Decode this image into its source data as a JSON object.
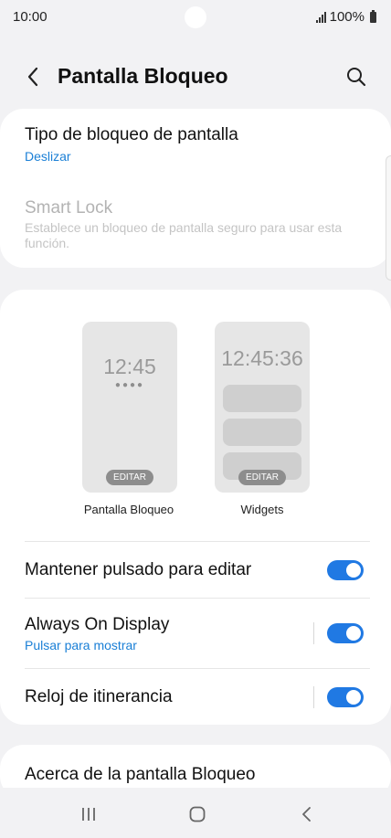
{
  "status_bar": {
    "time": "10:00",
    "battery": "100%"
  },
  "header": {
    "title": "Pantalla Bloqueo",
    "back_icon": "back-arrow-icon",
    "search_icon": "search-icon"
  },
  "security": {
    "lock_type": {
      "title": "Tipo de bloqueo de pantalla",
      "value": "Deslizar"
    },
    "smart_lock": {
      "title": "Smart Lock",
      "description": "Establece un bloqueo de pantalla seguro para usar esta función."
    }
  },
  "previews": [
    {
      "clock": "12:45",
      "dots": "●●●●",
      "edit": "EDITAR",
      "label": "Pantalla Bloqueo"
    },
    {
      "clock": "12:45:36",
      "edit": "EDITAR",
      "label": "Widgets"
    }
  ],
  "settings": [
    {
      "title": "Mantener pulsado para editar",
      "enabled": true
    },
    {
      "title": "Always On Display",
      "subtitle": "Pulsar para mostrar",
      "enabled": true
    },
    {
      "title": "Reloj de itinerancia",
      "enabled": true
    }
  ],
  "about": {
    "title": "Acerca de la pantalla Bloqueo"
  },
  "colors": {
    "accent": "#2079e3",
    "link": "#1a7fd6",
    "background": "#f2f2f4"
  }
}
